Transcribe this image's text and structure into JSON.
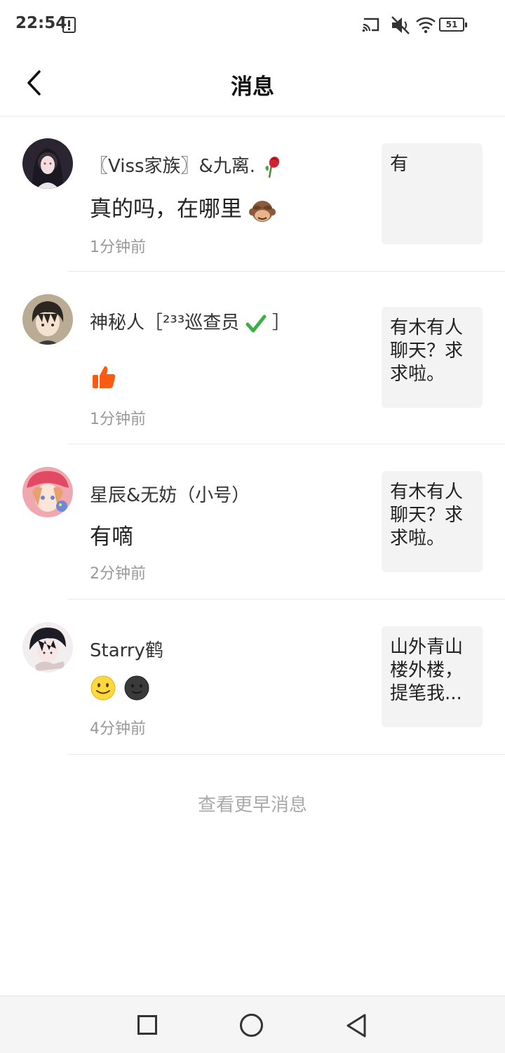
{
  "status_bar": {
    "time": "22:54",
    "battery_level": "51",
    "icons": [
      "alert-icon",
      "cast-icon",
      "mute-icon",
      "wifi-icon",
      "battery-icon"
    ]
  },
  "header": {
    "title": "消息",
    "back_icon": "chevron-left-icon"
  },
  "messages": [
    {
      "name": "〖Viss家族〗&九离.",
      "content": "真的吗，在哪里",
      "time": "1分钟前",
      "preview": "有",
      "avatar": "avatar-dark-haired-girl"
    },
    {
      "name": "神秘人［²³³巡查员",
      "content": "",
      "time": "1分钟前",
      "preview": "有木有人聊天？求求啦。",
      "avatar": "avatar-boy"
    },
    {
      "name": "星辰&无妨（小号）",
      "content": "有嘀",
      "time": "2分钟前",
      "preview": "有木有人聊天？求求啦。",
      "avatar": "avatar-pink-girl"
    },
    {
      "name": "Starry鹤",
      "content": "",
      "time": "4分钟前",
      "preview": "山外青山楼外楼，提笔我...",
      "avatar": "avatar-black-white"
    }
  ],
  "more_link": "查看更早消息",
  "nav_bar": {
    "icons": [
      "recent-apps-icon",
      "home-icon",
      "back-icon"
    ]
  }
}
